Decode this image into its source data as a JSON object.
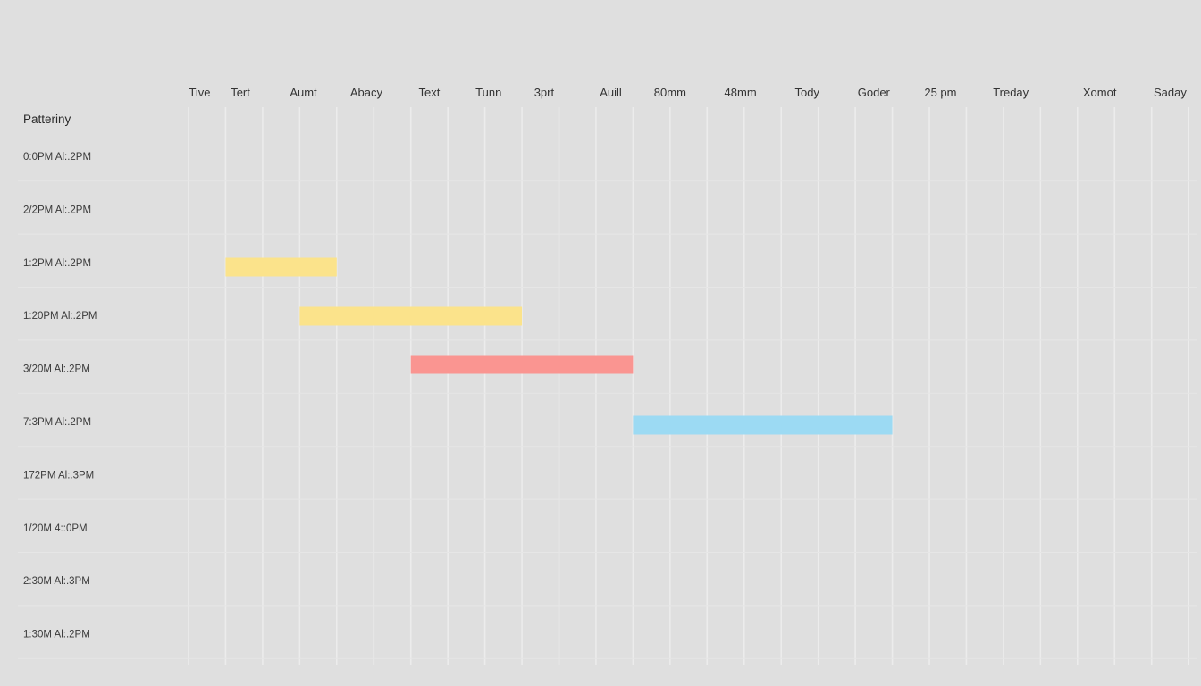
{
  "chart_data": {
    "type": "gantt",
    "title": "",
    "row_header": "Patteriny",
    "columns": [
      "Tive",
      "Tert",
      "Aumt",
      "Abacy",
      "Text",
      "Tunn",
      "3prt",
      "Auill",
      "80mm",
      "48mm",
      "Tody",
      "Goder",
      "25 pm",
      "Treday",
      "Xomot",
      "Saday"
    ],
    "column_label_grid_index": [
      0.3,
      1.4,
      3.1,
      4.8,
      6.5,
      8.1,
      9.6,
      11.4,
      13.0,
      14.9,
      16.7,
      18.5,
      20.3,
      22.2,
      24.6,
      26.5
    ],
    "grid_columns": 28,
    "rows": [
      "0:0PM Al:.2PM",
      "2/2PM Al:.2PM",
      "1:2PM Al:.2PM",
      "1:20PM Al:.2PM",
      "3/20M Al:.2PM",
      "7:3PM Al:.2PM",
      "172PM Al:.3PM",
      "1/20M 4::0PM",
      "2:30M Al:.3PM",
      "1:30M Al:.2PM"
    ],
    "bars": [
      {
        "row": 2,
        "start": 1,
        "end": 4,
        "color": "#fbe38b"
      },
      {
        "row": 3,
        "start": 3,
        "end": 9,
        "color": "#fbe38b"
      },
      {
        "row": 4,
        "start": 6,
        "end": 12,
        "color": "#fa9591"
      },
      {
        "row": 5,
        "start": 12,
        "end": 19,
        "color": "#9cdaf3"
      }
    ],
    "grid": true,
    "legend": "none"
  },
  "colors": {
    "background": "#dfdfdf",
    "grid": "#ececec",
    "bar_yellow": "#fbe38b",
    "bar_red": "#fa9591",
    "bar_blue": "#9cdaf3"
  }
}
